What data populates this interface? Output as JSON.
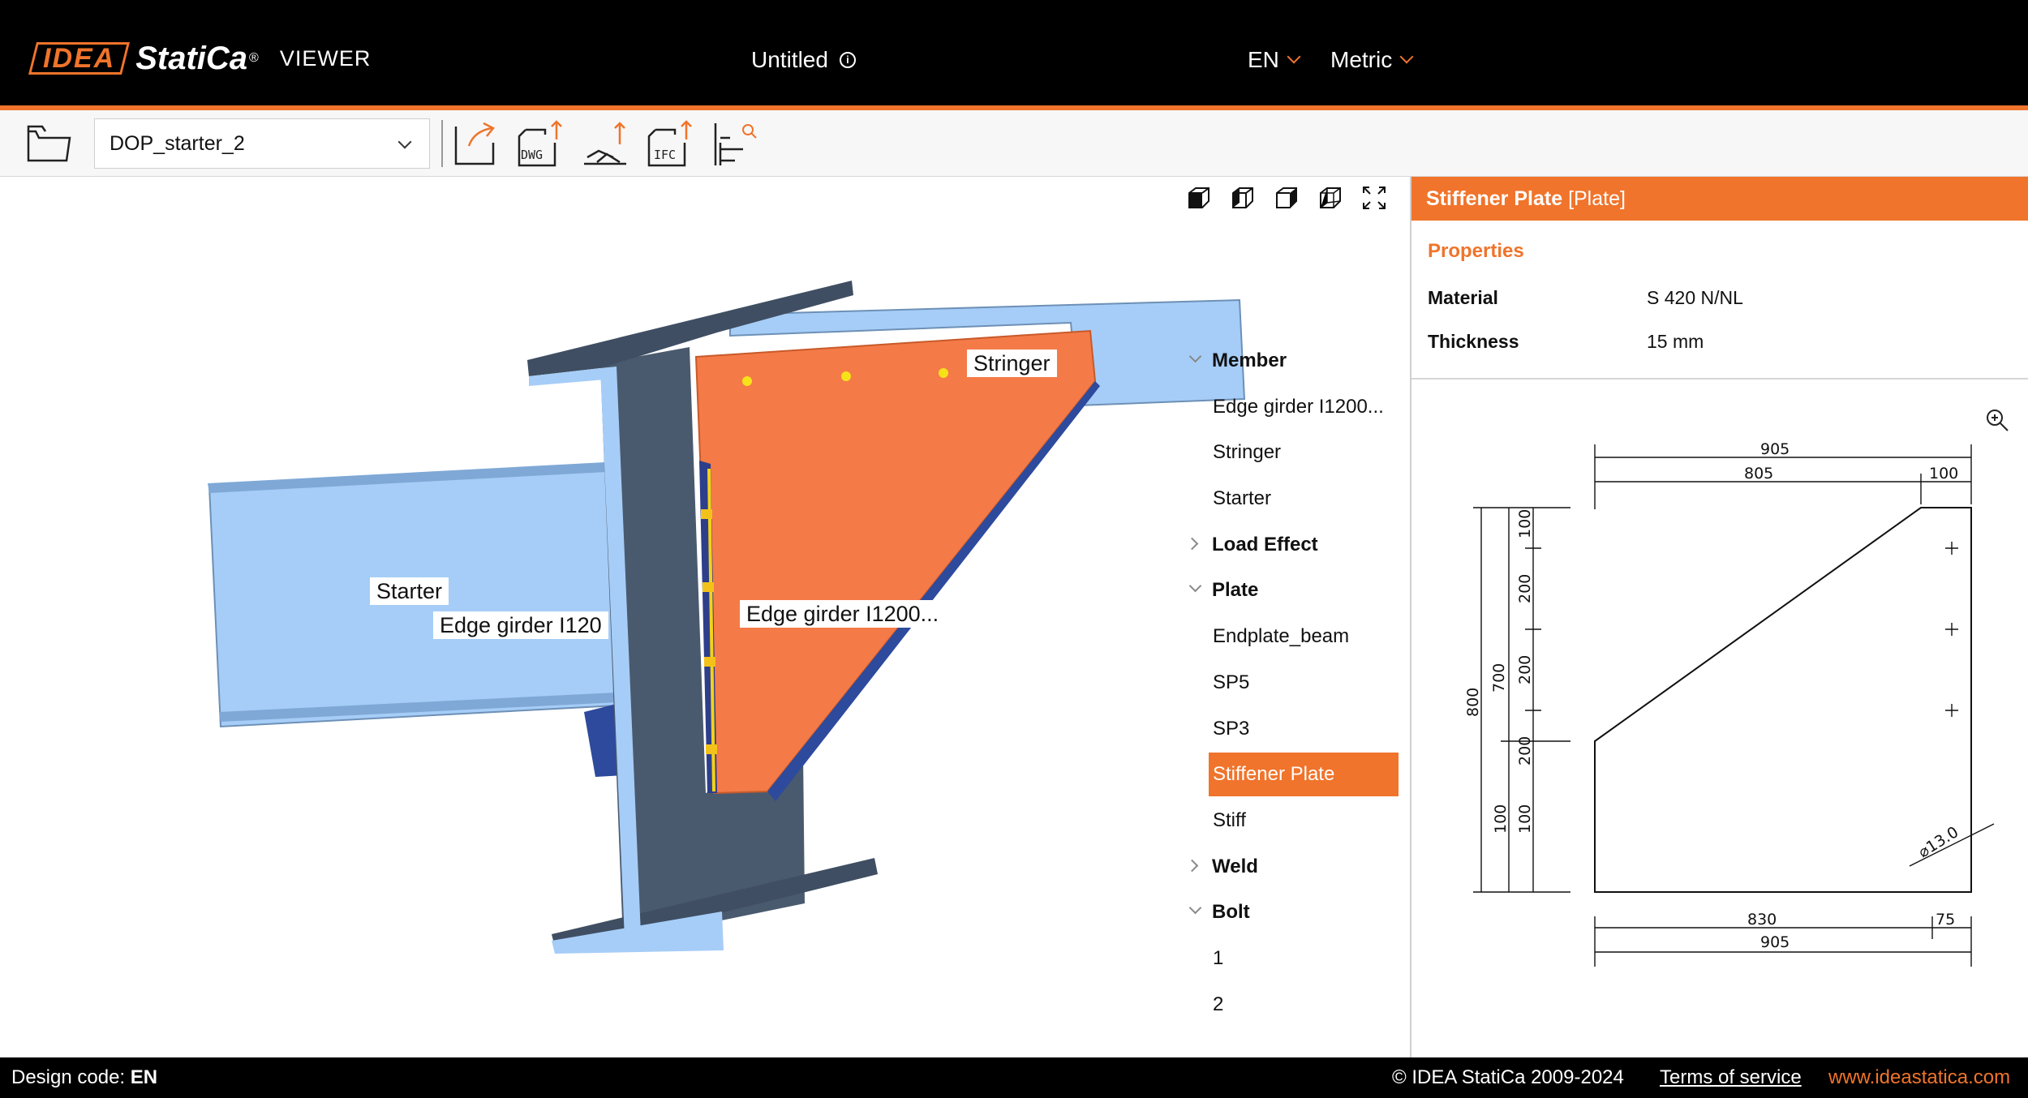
{
  "header": {
    "logo_mark": "IDEA",
    "logo_name": "StatiCa",
    "logo_reg": "®",
    "product": "VIEWER",
    "doc_title": "Untitled",
    "info_icon": "i",
    "language": "EN",
    "units": "Metric"
  },
  "toolbar": {
    "file_name": "DOP_starter_2",
    "icons": [
      "folder-icon",
      "export-icon",
      "dwg-export-icon",
      "scene-export-icon",
      "ifc-export-icon",
      "tree-search-icon"
    ],
    "dwg_label": "DWG",
    "ifc_label": "IFC"
  },
  "viewport": {
    "labels": {
      "stringer": "Stringer",
      "starter": "Starter",
      "edge_girder_left": "Edge girder I120",
      "edge_girder_center": "Edge girder I1200..."
    },
    "view_icons": [
      "cube-front-icon",
      "cube-left-icon",
      "cube-right-icon",
      "cube-iso-icon",
      "fit-view-icon"
    ]
  },
  "tree": {
    "member": "Member",
    "member_items": [
      "Edge girder I1200...",
      "Stringer",
      "Starter"
    ],
    "load_effect": "Load Effect",
    "plate": "Plate",
    "plate_items": [
      "Endplate_beam",
      "SP5",
      "SP3",
      "Stiffener Plate",
      "Stiff"
    ],
    "weld": "Weld",
    "bolt": "Bolt",
    "bolt_items": [
      "1",
      "2"
    ]
  },
  "panel": {
    "title": "Stiffener Plate",
    "type": "[Plate]",
    "properties_title": "Properties",
    "material_label": "Material",
    "material_value": "S 420 N/NL",
    "thickness_label": "Thickness",
    "thickness_value": "15 mm"
  },
  "drawing": {
    "top_total": "905",
    "top_left": "805",
    "top_right": "100",
    "left_total": "800",
    "left_inner": "700",
    "left_segments": [
      "100",
      "200",
      "200",
      "200",
      "100"
    ],
    "left_bottom_extra": "100",
    "bottom_left": "830",
    "bottom_right": "75",
    "bottom_total": "905",
    "hole": "⌀13.0"
  },
  "footer": {
    "design_code_label": "Design code:",
    "design_code_value": "EN",
    "copyright": "© IDEA StatiCa 2009-2024",
    "terms": "Terms of service",
    "website": "www.ideastatica.com"
  },
  "colors": {
    "accent": "#f0742b",
    "header_bg": "#000000",
    "beam_blue": "#a6cdf7",
    "column_dark": "#4a5a6e"
  }
}
